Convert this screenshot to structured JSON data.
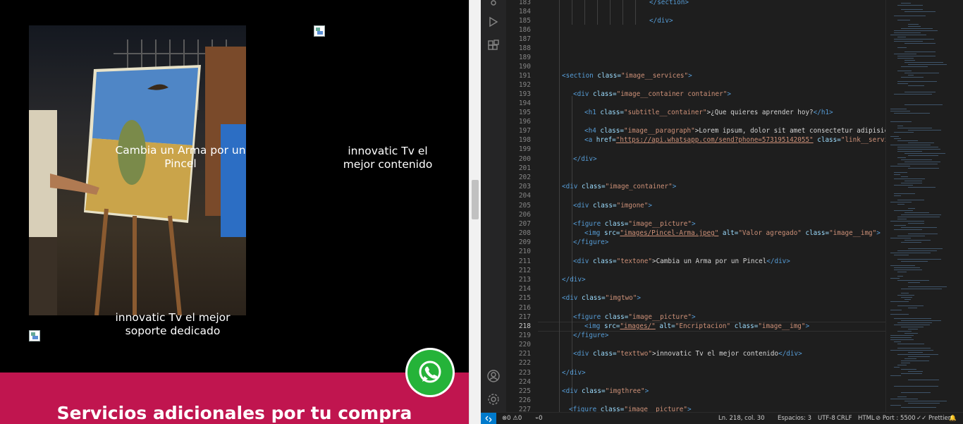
{
  "preview": {
    "image_one_caption": "Cambia un Arma por un Pincel",
    "image_two_caption": "innovatic Tv el mejor contenido",
    "image_three_caption": "innovatic Tv el mejor soporte dedicado",
    "section_title": "Servicios adicionales por tu compra",
    "brand_color": "#c0154f",
    "whatsapp_color": "#25b339"
  },
  "editor": {
    "line_numbers": [
      "183",
      "184",
      "185",
      "186",
      "187",
      "188",
      "189",
      "190",
      "191",
      "192",
      "193",
      "194",
      "195",
      "196",
      "197",
      "198",
      "199",
      "200",
      "201",
      "202",
      "203",
      "204",
      "205",
      "206",
      "207",
      "208",
      "209",
      "210",
      "211",
      "212",
      "213",
      "214",
      "215",
      "216",
      "217",
      "218",
      "219",
      "220",
      "221",
      "222",
      "223",
      "224",
      "225",
      "226",
      "227"
    ],
    "active_line": "218",
    "code": {
      "l183": "</section>",
      "l185": "</div>",
      "l191_tag": "<section ",
      "l191_attr": "class=",
      "l191_str": "\"image__services\"",
      "l191_end": ">",
      "l193_tag": "<div ",
      "l193_attr": "class=",
      "l193_str": "\"image__container container\"",
      "l193_end": ">",
      "l195_tag": "<h1 ",
      "l195_attr": "class=",
      "l195_str": "\"subtitle__container\"",
      "l195_text": ">¿Que quieres aprender hoy?",
      "l195_end": "</h1>",
      "l197_tag": "<h4 ",
      "l197_attr": "class=",
      "l197_str": "\"image__paragraph\"",
      "l197_text": ">Lorem ipsum, dolor sit amet consectetur adipisicing",
      "l198_tag": "<a ",
      "l198_attr": "href=",
      "l198_str": "\"https://api.whatsapp.com/send?phone=573195142055\"",
      "l198_attr2": " class=",
      "l198_str2": "\"link__services",
      "l200": "</div>",
      "l203_tag": "<div ",
      "l203_attr": "class=",
      "l203_str": "\"image_container\"",
      "l203_end": ">",
      "l205_tag": "<div ",
      "l205_attr": "class=",
      "l205_str": "\"imgone\"",
      "l205_end": ">",
      "l207_tag": "<figure ",
      "l207_attr": "class=",
      "l207_str": "\"image__picture\"",
      "l207_end": ">",
      "l208_tag": "<img ",
      "l208_attr": "src=",
      "l208_str": "\"images/Pincel-Arma.jpeg\"",
      "l208_attr2": " alt=",
      "l208_str2": "\"Valor agregado\"",
      "l208_attr3": " class=",
      "l208_str3": "\"image__img\"",
      "l208_end": ">",
      "l209": "</figure>",
      "l211_tag": "<div ",
      "l211_attr": "class=",
      "l211_str": "\"textone\"",
      "l211_text": ">Cambia un Arma por un Pincel",
      "l211_end": "</div>",
      "l213": "</div>",
      "l215_tag": "<div ",
      "l215_attr": "class=",
      "l215_str": "\"imgtwo\"",
      "l215_end": ">",
      "l217_tag": "<figure ",
      "l217_attr": "class=",
      "l217_str": "\"image__picture\"",
      "l217_end": ">",
      "l218_tag": "<img ",
      "l218_attr": "src=",
      "l218_str": "\"images/\"",
      "l218_attr2": " alt=",
      "l218_str2": "\"Encriptacion\"",
      "l218_attr3": " class=",
      "l218_str3": "\"image__img\"",
      "l218_end": ">",
      "l219": "</figure>",
      "l221_tag": "<div ",
      "l221_attr": "class=",
      "l221_str": "\"texttwo\"",
      "l221_text": ">innovatic Tv el mejor contenido",
      "l221_end": "</div>",
      "l223": "</div>",
      "l225_tag": "<div ",
      "l225_attr": "class=",
      "l225_str": "\"imgthree\"",
      "l225_end": ">",
      "l227_tag": "<figure ",
      "l227_attr": "class=",
      "l227_str": "\"image__picture\"",
      "l227_end": ">"
    }
  },
  "statusbar": {
    "errors": "0",
    "warnings": "0",
    "ports": "0",
    "cursor": "Ln. 218, col. 30",
    "spaces": "Espacios: 3",
    "encoding": "UTF-8",
    "eol": "CRLF",
    "language": "HTML",
    "port": "Port : 5500",
    "prettier": "Prettier"
  }
}
